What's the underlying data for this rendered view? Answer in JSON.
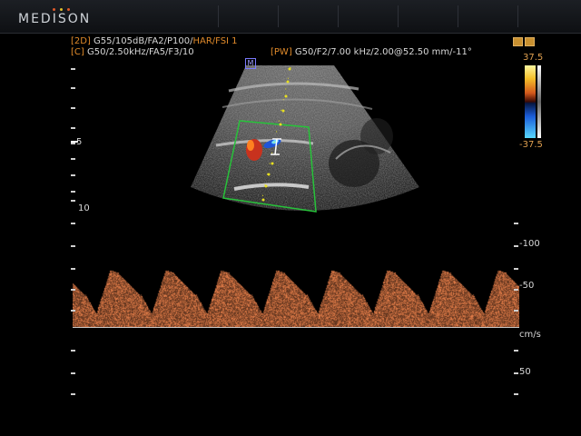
{
  "brand": {
    "logo_text": "MEDISON",
    "dot_colors": [
      "#e05a2a",
      "#e0c02a",
      "#e05a2a"
    ]
  },
  "header": {
    "mode_2d_tag": "[2D]",
    "mode_2d_params": " G55/105dB/FA2/P100/",
    "mode_2d_har": "HAR/FSI 1",
    "mode_c_tag": "[C]",
    "mode_c_params": " G50/2.50kHz/FA5/F3/10",
    "mode_pw_tag": "[PW]",
    "mode_pw_params": " G50/F2/7.00 kHz/2.00@52.50 mm/-11°"
  },
  "focus_marker": "M",
  "depth": {
    "mark_5": "5",
    "mark_10": "10"
  },
  "color_scale": {
    "max": "37.5",
    "min": "-37.5"
  },
  "velocity_scale": {
    "label_minus_100": "-100",
    "label_minus_50": "-50",
    "unit": "cm/s",
    "label_50": "50"
  },
  "colors": {
    "accent_orange": "#e08a2a",
    "roi_green": "#27c23a",
    "gate_yellow": "#e8e020",
    "doppler_brown": "#c87a4a"
  }
}
